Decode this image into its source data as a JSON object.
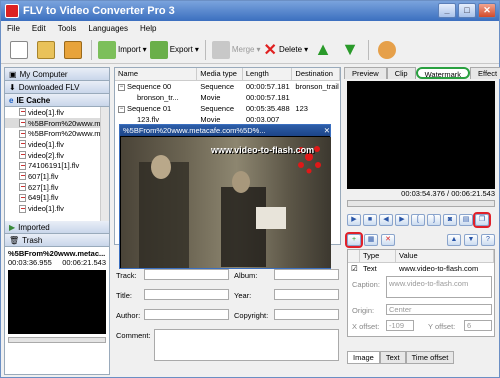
{
  "window": {
    "title": "FLV to Video Converter Pro 3",
    "close_symbol": "✕",
    "max_symbol": "□",
    "min_symbol": "_"
  },
  "menu": [
    "File",
    "Edit",
    "Tools",
    "Languages",
    "Help"
  ],
  "toolbar": {
    "import_label": "Import",
    "export_label": "Export",
    "merge_label": "Merge",
    "delete_label": "Delete"
  },
  "left": {
    "my_computer": "My Computer",
    "downloaded": "Downloaded FLV",
    "ie_cache": "IE Cache",
    "files": [
      "video[1].flv",
      "%5BFrom%20www.m",
      "%5BFrom%20www.m",
      "video[1].flv",
      "video[2].flv",
      "74106191[1].flv",
      "607[1].flv",
      "627[1].flv",
      "649[1].flv",
      "video[1].flv"
    ],
    "imported": "Imported",
    "trash": "Trash",
    "preview_name": "%5BFrom%20www.metac...",
    "preview_time_a": "00:03:36.955",
    "preview_time_b": "00:06:21.543"
  },
  "list": {
    "headers": [
      "Name",
      "Media type",
      "Length",
      "Destination"
    ],
    "rows": [
      {
        "name": "Sequence 00",
        "type": "Sequence",
        "length": "00:00:57.181",
        "dest": "bronson_trail"
      },
      {
        "name": "bronson_tr...",
        "type": "Movie",
        "length": "00:00:57.181",
        "dest": ""
      },
      {
        "name": "Sequence 01",
        "type": "Sequence",
        "length": "00:05:35.488",
        "dest": "123"
      },
      {
        "name": "123.flv",
        "type": "Movie",
        "length": "00:03.007",
        "dest": ""
      }
    ]
  },
  "popup": {
    "title": "%5BFrom%20www.metacafe.com%5D%...",
    "watermark_text": "www.video-to-flash.com"
  },
  "tagform": {
    "track": "Track:",
    "album": "Album:",
    "title": "Title:",
    "year": "Year:",
    "author": "Author:",
    "copyright": "Copyright:",
    "comment": "Comment:"
  },
  "right": {
    "tabs": [
      "Preview",
      "Clip",
      "Watermark",
      "Effect"
    ],
    "time_display": "00:03:54.376 / 00:06:21.543",
    "wm_headers": [
      "Type",
      "Value"
    ],
    "wm_row": {
      "type": "Text",
      "value": "www.video-to-flash.com"
    },
    "caption_label": "Caption:",
    "caption_value": "www.video-to-flash.com",
    "origin_label": "Origin:",
    "origin_value": "Center",
    "xoffset_label": "X offset:",
    "xoffset_value": "-109",
    "yoffset_label": "Y offset:",
    "yoffset_value": "6",
    "bottom_tabs": [
      "Image",
      "Text",
      "Time offset"
    ]
  }
}
